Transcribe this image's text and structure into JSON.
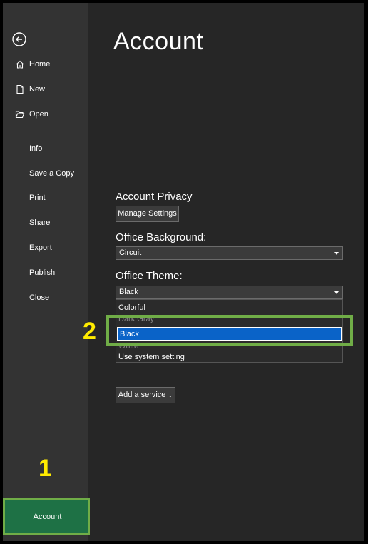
{
  "sidebar": {
    "items": [
      {
        "label": "Home",
        "icon": "home-icon"
      },
      {
        "label": "New",
        "icon": "new-document-icon"
      },
      {
        "label": "Open",
        "icon": "open-folder-icon"
      },
      {
        "label": "Info"
      },
      {
        "label": "Save a Copy"
      },
      {
        "label": "Print"
      },
      {
        "label": "Share"
      },
      {
        "label": "Export"
      },
      {
        "label": "Publish"
      },
      {
        "label": "Close"
      }
    ],
    "account_label": "Account"
  },
  "main": {
    "title": "Account",
    "privacy": {
      "label": "Account Privacy",
      "button": "Manage Settings"
    },
    "background": {
      "label": "Office Background:",
      "value": "Circuit"
    },
    "theme": {
      "label": "Office Theme:",
      "value": "Black",
      "options": [
        "Colorful",
        "Dark Gray",
        "Black",
        "White",
        "Use system setting"
      ],
      "selected": "Black"
    },
    "add_service": "Add a service"
  },
  "annotations": {
    "step1": "1",
    "step2": "2"
  },
  "colors": {
    "highlight": "#70ad47",
    "accent": "#1e7145",
    "step": "#ffeb00",
    "selection": "#0a63c8"
  }
}
